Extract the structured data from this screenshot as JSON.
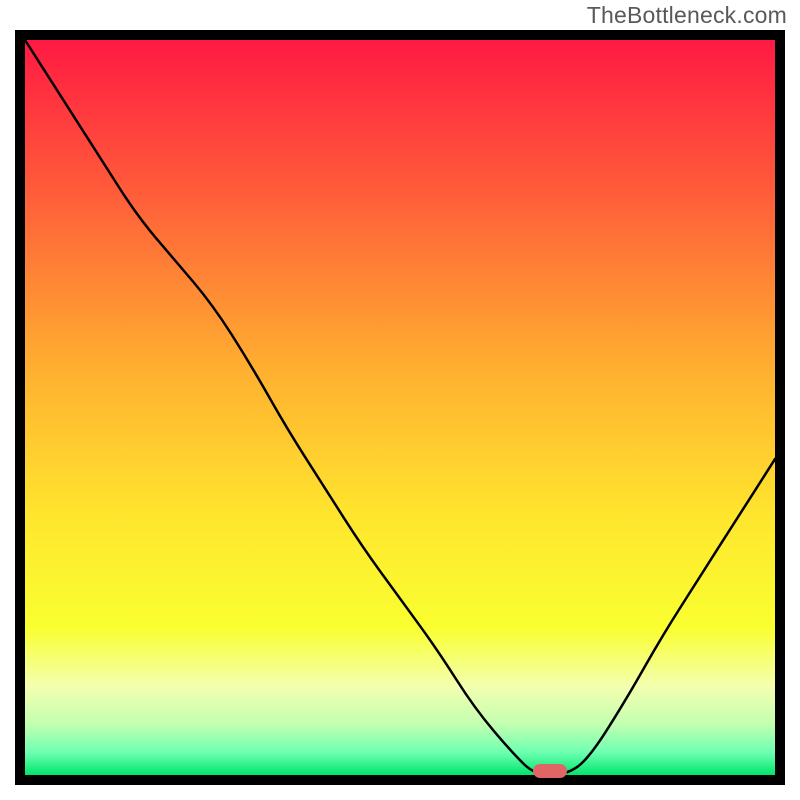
{
  "watermark": "TheBottleneck.com",
  "chart_data": {
    "type": "line",
    "title": "",
    "xlabel": "",
    "ylabel": "",
    "xlim": [
      0,
      100
    ],
    "ylim": [
      0,
      100
    ],
    "x": [
      0,
      5,
      10,
      15,
      20,
      25,
      30,
      35,
      40,
      45,
      50,
      55,
      60,
      65,
      68,
      72,
      75,
      80,
      85,
      90,
      95,
      100
    ],
    "values": [
      100,
      92,
      84,
      76,
      70,
      64,
      56,
      47,
      39,
      31,
      24,
      17,
      9,
      3,
      0,
      0,
      2,
      10,
      19,
      27,
      35,
      43
    ],
    "marker": {
      "x": 70,
      "y": 0,
      "color": "#e06666",
      "shape": "rounded-rect"
    },
    "gradient_stops": [
      {
        "offset": 0.0,
        "color": "#ff1a43"
      },
      {
        "offset": 0.2,
        "color": "#ff5a3a"
      },
      {
        "offset": 0.45,
        "color": "#ffb030"
      },
      {
        "offset": 0.65,
        "color": "#ffe62e"
      },
      {
        "offset": 0.8,
        "color": "#f9ff30"
      },
      {
        "offset": 0.88,
        "color": "#f3ffb0"
      },
      {
        "offset": 0.93,
        "color": "#c4ffb0"
      },
      {
        "offset": 0.97,
        "color": "#6bffb0"
      },
      {
        "offset": 1.0,
        "color": "#00e66b"
      }
    ],
    "border_color": "#000000",
    "border_width": 10,
    "curve_color": "#000000",
    "curve_width": 2.5
  }
}
